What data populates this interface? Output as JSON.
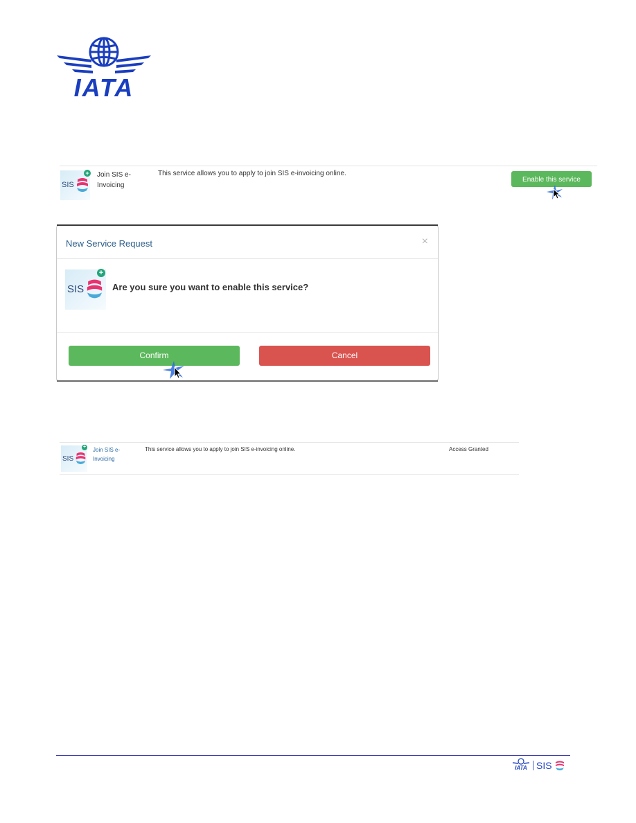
{
  "logo": {
    "text": "IATA",
    "color": "#1a3ebf"
  },
  "service_row_1": {
    "badge_text": "SIS",
    "name": "Join SIS e-Invoicing",
    "description": "This service allows you to apply to join SIS e-invoicing online.",
    "enable_button": "Enable this service"
  },
  "modal": {
    "title": "New Service Request",
    "close_glyph": "×",
    "badge_text": "SIS",
    "question": "Are you sure you want to enable this service?",
    "confirm_label": "Confirm",
    "cancel_label": "Cancel"
  },
  "service_row_2": {
    "badge_text": "SIS",
    "name": "Join SIS e-Invoicing",
    "description": "This service allows you to apply to join SIS e-invoicing online.",
    "status": "Access Granted"
  },
  "footer": {
    "iata_text": "IATA",
    "sis_text": "SIS"
  },
  "colors": {
    "green": "#5cb85c",
    "red": "#d9534f",
    "brand_blue": "#1a3ebf",
    "link": "#2e6da4"
  },
  "icons": [
    "globe-icon",
    "sis-logo-icon",
    "plus-icon",
    "close-icon",
    "cursor-icon"
  ]
}
